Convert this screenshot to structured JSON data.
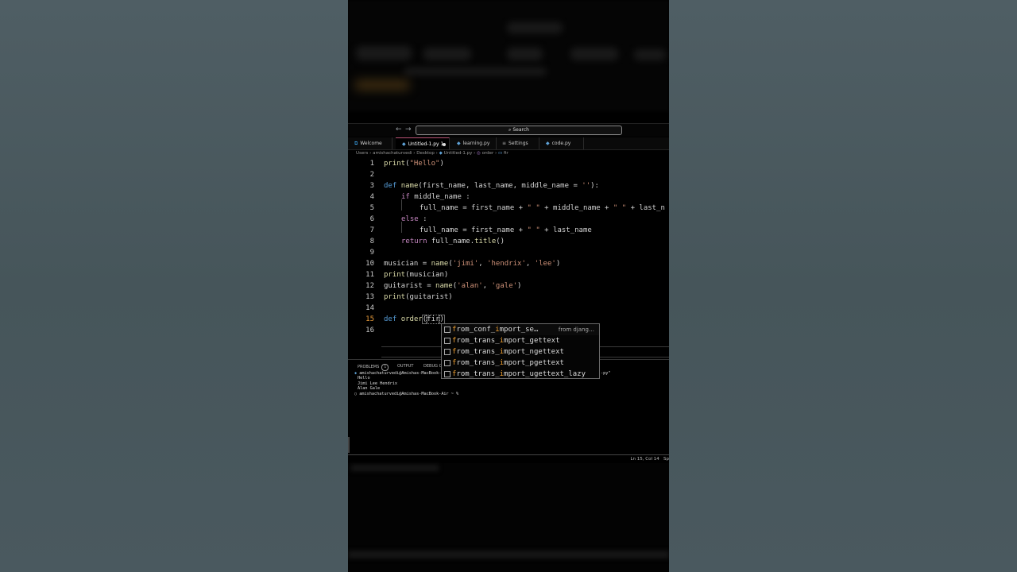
{
  "search": {
    "label": "Search"
  },
  "nav": {
    "back": "←",
    "forward": "→"
  },
  "tabs": [
    {
      "label": "Welcome",
      "icon": "vscode-icon"
    },
    {
      "label": "Untitled-1.py",
      "badge": "1",
      "icon": "python-icon"
    },
    {
      "label": "learning.py",
      "icon": "python-icon"
    },
    {
      "label": "Settings",
      "icon": "settings-icon"
    },
    {
      "label": "code.py",
      "icon": "python-icon"
    }
  ],
  "breadcrumb": {
    "parts": [
      "Users",
      "amishachaturvedi",
      "Desktop",
      "Untitled-1.py",
      "order",
      "fir"
    ],
    "separator": " › "
  },
  "editor": {
    "line_numbers": [
      "1",
      "2",
      "3",
      "4",
      "5",
      "6",
      "7",
      "8",
      "9",
      "10",
      "11",
      "12",
      "13",
      "14",
      "15",
      "16"
    ],
    "current_line": "15",
    "code": {
      "l1": {
        "a": "print",
        "b": "(",
        "c": "\"Hello\"",
        "d": ")"
      },
      "l3": {
        "a": "def ",
        "b": "name",
        "c": "(first_name, last_name, middle_name = ",
        "d": "''",
        "e": "):"
      },
      "l4": {
        "a": "if ",
        "b": "middle_name",
        "c": " :"
      },
      "l5": {
        "a": "full_name",
        "b": " = ",
        "c": "first_name",
        "d": " + ",
        "e": "\" \"",
        "f": " + ",
        "g": "middle_name",
        "h": " + ",
        "i": "\" \"",
        "j": " + last_n"
      },
      "l6": {
        "a": "else",
        "b": " :"
      },
      "l7": {
        "a": "full_name",
        "b": " = ",
        "c": "first_name",
        "d": " + ",
        "e": "\" \"",
        "f": " + ",
        "g": "last_name"
      },
      "l8": {
        "a": "return ",
        "b": "full_name",
        "c": ".",
        "d": "title",
        "e": "()"
      },
      "l10": {
        "a": "musician",
        "b": " = ",
        "c": "name",
        "d": "(",
        "e": "'jimi'",
        "f": ", ",
        "g": "'hendrix'",
        "h": ", ",
        "i": "'lee'",
        "j": ")"
      },
      "l11": {
        "a": "print",
        "b": "(musician)"
      },
      "l12": {
        "a": "guitarist",
        "b": " = ",
        "c": "name",
        "d": "(",
        "e": "'alan'",
        "f": ", ",
        "g": "'gale'",
        "h": ")"
      },
      "l13": {
        "a": "print",
        "b": "(guitarist)"
      },
      "l15": {
        "a": "def ",
        "b": "order",
        "c": "(",
        "d": "fir",
        "e": ")"
      }
    }
  },
  "suggestions": [
    {
      "match": "f",
      "pre": "",
      "mid": "r",
      "rest_a": "om_conf_",
      "i": "i",
      "rest_b": "mport_se…",
      "detail": "from djang…"
    },
    {
      "match": "f",
      "pre": "",
      "mid": "r",
      "rest_a": "om_trans_",
      "i": "i",
      "rest_b": "mport_gettext",
      "detail": ""
    },
    {
      "match": "f",
      "pre": "",
      "mid": "r",
      "rest_a": "om_trans_",
      "i": "i",
      "rest_b": "mport_ngettext",
      "detail": ""
    },
    {
      "match": "f",
      "pre": "",
      "mid": "r",
      "rest_a": "om_trans_",
      "i": "i",
      "rest_b": "mport_pgettext",
      "detail": ""
    },
    {
      "match": "f",
      "pre": "",
      "mid": "r",
      "rest_a": "om_trans_",
      "i": "i",
      "rest_b": "mport_ugettext_lazy",
      "detail": ""
    }
  ],
  "panel": {
    "tabs": {
      "problems": "PROBLEMS",
      "problems_count": "1",
      "output": "OUTPUT",
      "debug": "DEBUG C"
    },
    "terminal": [
      "amishachaturvedi@Amishas-MacBook-Air",
      "Hello",
      "Jimi Lee Hendrix",
      "Alan Gale",
      "amishachaturvedi@Amishas-MacBook-Air ~ %"
    ],
    "terminal_tail": "-py\"",
    "prompt_markers": [
      "◆",
      "○"
    ]
  },
  "status": {
    "position": "Ln 15, Col 14",
    "spaces": "Sp"
  },
  "colors": {
    "keyword": "#569cd6",
    "function": "#dcdcaa",
    "string": "#ce9178",
    "variable": "#9cdcfe",
    "match": "#f0a030"
  }
}
